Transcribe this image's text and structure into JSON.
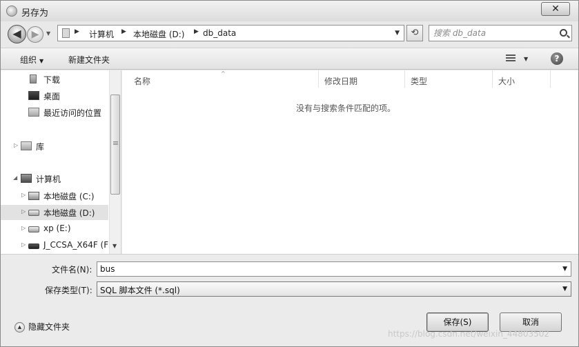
{
  "window": {
    "title": "另存为",
    "close_label": "✕"
  },
  "nav": {
    "back_glyph": "◀",
    "forward_glyph": "▶",
    "breadcrumbs": [
      "计算机",
      "本地磁盘 (D:)",
      "db_data"
    ],
    "refresh_glyph": "⟲",
    "search_placeholder": "搜索 db_data"
  },
  "toolbar": {
    "organize_label": "组织",
    "new_folder_label": "新建文件夹",
    "help_glyph": "?"
  },
  "sidebar": {
    "items": [
      {
        "label": "下载",
        "icon": "download-folder-icon"
      },
      {
        "label": "桌面",
        "icon": "desktop-icon"
      },
      {
        "label": "最近访问的位置",
        "icon": "recent-places-icon"
      },
      {
        "label": "库",
        "icon": "library-icon"
      },
      {
        "label": "计算机",
        "icon": "computer-icon"
      },
      {
        "label": "本地磁盘 (C:)",
        "icon": "system-drive-icon"
      },
      {
        "label": "本地磁盘 (D:)",
        "icon": "drive-icon",
        "selected": true
      },
      {
        "label": "xp (E:)",
        "icon": "drive-icon"
      },
      {
        "label": "J_CCSA_X64F (F",
        "icon": "dvd-drive-icon"
      }
    ]
  },
  "filelist": {
    "columns": [
      "名称",
      "修改日期",
      "类型",
      "大小"
    ],
    "empty_message": "没有与搜索条件匹配的项。"
  },
  "form": {
    "filename_label": "文件名(N):",
    "filename_value": "bus",
    "filetype_label": "保存类型(T):",
    "filetype_value": "SQL 脚本文件 (*.sql)",
    "hide_folders_label": "隐藏文件夹",
    "save_label": "保存(S)",
    "cancel_label": "取消"
  },
  "watermark": "https://blog.csdn.net/weixin_44803502"
}
